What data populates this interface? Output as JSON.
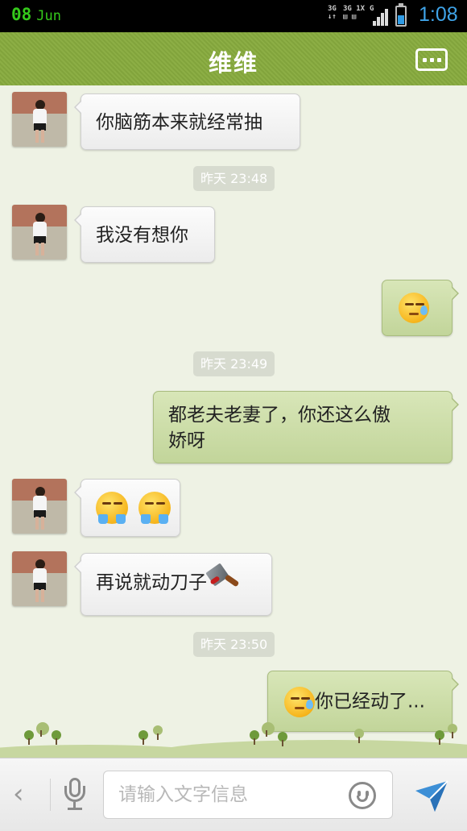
{
  "status_bar": {
    "date_day": "08",
    "date_month": "Jun",
    "net_label_1": "3G",
    "net_label_2": "3G 1X",
    "net_label_3": "G",
    "time": "1:08"
  },
  "header": {
    "title": "维维",
    "more_icon": "more-dots-icon"
  },
  "messages": [
    {
      "type": "received",
      "text": "你脑筋本来就经常抽"
    },
    {
      "type": "timestamp",
      "text": "昨天 23:48"
    },
    {
      "type": "received",
      "text": "我没有想你"
    },
    {
      "type": "sent",
      "emoji": "sweat-face-emoji"
    },
    {
      "type": "timestamp",
      "text": "昨天 23:49"
    },
    {
      "type": "sent",
      "line1": "都老夫老妻了，你还这么傲",
      "line2": "娇呀"
    },
    {
      "type": "received",
      "emoji": [
        "crying-face-emoji",
        "crying-face-emoji"
      ]
    },
    {
      "type": "received",
      "text": "再说就动刀子",
      "emoji": "cleaver-icon"
    },
    {
      "type": "timestamp",
      "text": "昨天 23:50"
    },
    {
      "type": "sent",
      "emoji": "sweat-face-emoji",
      "text": "你已经动了..."
    }
  ],
  "input_bar": {
    "placeholder": "请输入文字信息",
    "icons": [
      "chevron-left-icon",
      "microphone-icon",
      "smiley-icon",
      "send-icon"
    ]
  },
  "colors": {
    "header_green": "#8cae45",
    "sent_bubble": "#c8daa2",
    "received_bubble": "#f4f4f4",
    "background": "#eef2e4",
    "date_green": "#35c91b",
    "time_blue": "#3fa3e8"
  }
}
